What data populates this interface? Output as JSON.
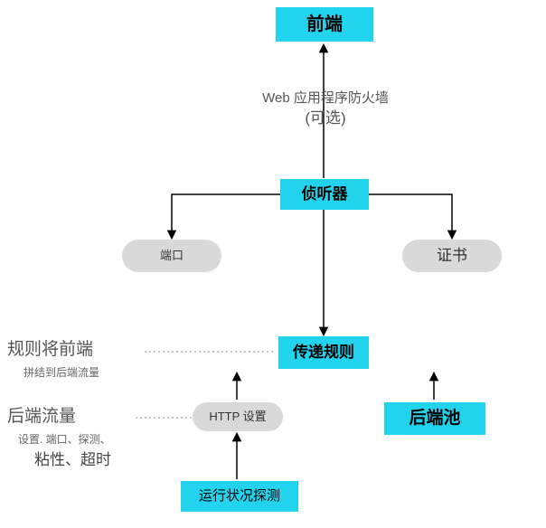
{
  "nodes": {
    "frontend": "前端",
    "listener": "侦听器",
    "port": "端口",
    "cert": "证书",
    "rule": "传递规则",
    "httpset": "HTTP 设置",
    "backend": "后端池",
    "probe": "运行状况探测"
  },
  "labels": {
    "waf_line1": "Web 应用程序防火墙",
    "waf_line2": "(可选)",
    "side1_big": "规则将前端",
    "side1_small": "拼结到后端流量",
    "side2_big": "后端流量",
    "side2_small": "设置. 端口、探测、",
    "side2_sub": "粘性、超时"
  }
}
